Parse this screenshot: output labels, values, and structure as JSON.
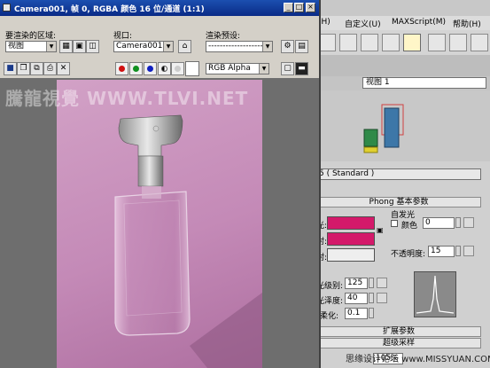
{
  "render_window": {
    "title": "Camera001, 帧 0, RGBA 颜色 16 位/通道 (1:1)",
    "area_label": "要渲染的区域:",
    "area_value": "视图",
    "viewport_label": "视口:",
    "viewport_value": "Camera001",
    "preset_label": "渲染预设:",
    "preset_value": "--------------------",
    "channel_value": "RGB Alpha",
    "minimize": "_",
    "maximize": "□",
    "close": "×"
  },
  "watermark": "騰龍視覺 WWW.TLVI.NET",
  "menubar": {
    "items": [
      "(H)",
      "自定义(U)",
      "MAXScript(M)",
      "帮助(H)"
    ]
  },
  "viewport": {
    "label": "视图 1"
  },
  "material": {
    "name_suffix": "5 ( Standard )",
    "rollout_phong": "Phong 基本参数",
    "self_illum": "自发光",
    "color_label": "颜色",
    "color_value": "0",
    "opacity_label": "不透明度:",
    "opacity_value": "15",
    "ambient_label": "光:",
    "diffuse_label": "射:",
    "specular_label": "射:",
    "spec_level_label": "光级别:",
    "spec_level_value": "125",
    "gloss_label": "光泽度:",
    "gloss_value": "40",
    "soften_label": "柔化:",
    "soften_value": "0.1",
    "rollout_extended": "扩展参数",
    "rollout_supersample": "超级采样",
    "zoom": "105%"
  },
  "bottom_watermark": "思缘设计论坛  www.MISSYUAN.COM",
  "colors": {
    "ambient": "#d4196a",
    "diffuse": "#d4196a",
    "specular": "#eeeeee",
    "render_bg": "#c48ab7"
  }
}
